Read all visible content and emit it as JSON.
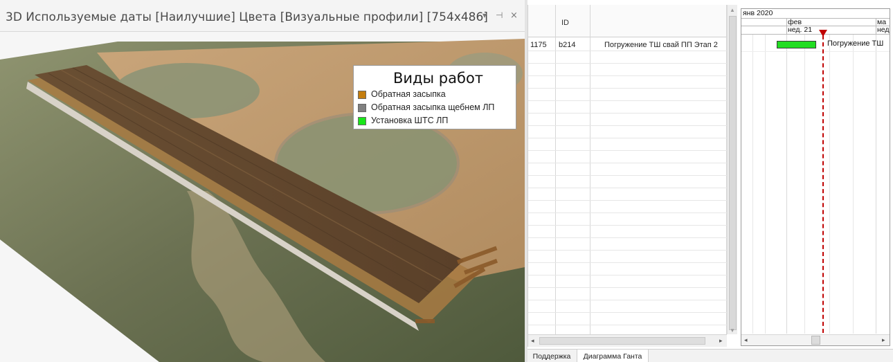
{
  "viewer": {
    "title": "3D Используемые даты [Наилучшие] Цвета [Визуальные профили]  [754x486]",
    "dropdown_glyph": "▾",
    "pin_glyph": "⊣",
    "close_glyph": "×",
    "legend": {
      "title": "Виды работ",
      "items": [
        {
          "label": "Обратная засыпка",
          "color": "#c47d0e"
        },
        {
          "label": "Обратная засыпка щебнем ЛП",
          "color": "#808080"
        },
        {
          "label": "Установка ШТС ЛП",
          "color": "#19e619"
        }
      ]
    }
  },
  "gantt": {
    "columns": {
      "id_header": "ID"
    },
    "rows": [
      {
        "num": "1175",
        "id": "b214",
        "name": "Погружение ТШ свай ПП Этап 2"
      }
    ],
    "timeline": {
      "month_top": "янв 2020",
      "month_feb": "фев",
      "month_mar": "ма",
      "week": "нед. 21",
      "week_next": "нед",
      "bar_label": "Погружение ТШ",
      "bar_color": "#22dd22",
      "today_color": "#c00000"
    },
    "tabs": [
      {
        "label": "Поддержка"
      },
      {
        "label": "Диаграмма Ганта"
      }
    ]
  }
}
